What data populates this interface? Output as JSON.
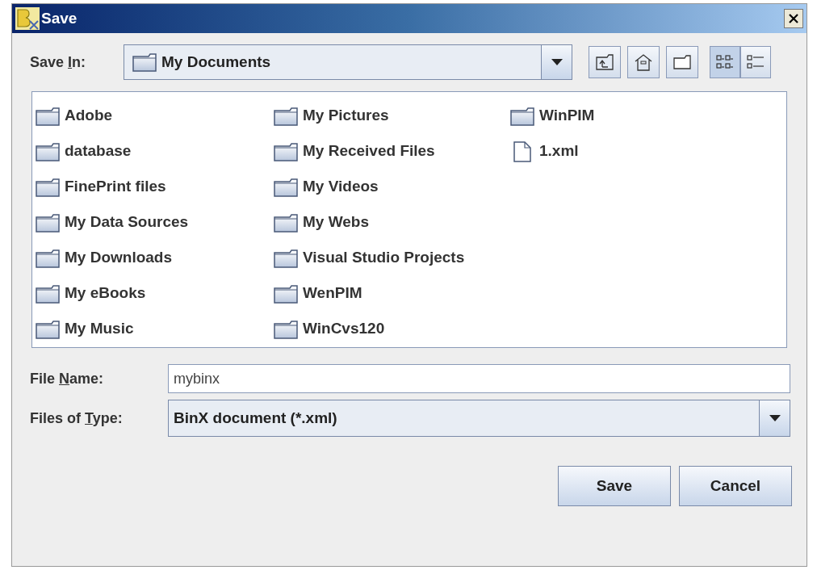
{
  "window": {
    "title": "Save"
  },
  "save_in": {
    "label": {
      "before": "Save ",
      "key": "I",
      "after": "n:"
    },
    "value": "My Documents"
  },
  "toolbar": [
    {
      "kind": "up"
    },
    {
      "kind": "home"
    },
    {
      "kind": "new_folder"
    }
  ],
  "view_toggle": [
    {
      "kind": "list",
      "selected": true
    },
    {
      "kind": "details",
      "selected": false
    }
  ],
  "files": [
    {
      "name": "Adobe",
      "kind": "folder"
    },
    {
      "name": "database",
      "kind": "folder"
    },
    {
      "name": "FinePrint files",
      "kind": "folder"
    },
    {
      "name": "My Data Sources",
      "kind": "folder"
    },
    {
      "name": "My Downloads",
      "kind": "folder"
    },
    {
      "name": "My eBooks",
      "kind": "folder"
    },
    {
      "name": "My Music",
      "kind": "folder"
    },
    {
      "name": "My Pictures",
      "kind": "folder"
    },
    {
      "name": "My Received Files",
      "kind": "folder"
    },
    {
      "name": "My Videos",
      "kind": "folder"
    },
    {
      "name": "My Webs",
      "kind": "folder"
    },
    {
      "name": "Visual Studio Projects",
      "kind": "folder"
    },
    {
      "name": "WenPIM",
      "kind": "folder"
    },
    {
      "name": "WinCvs120",
      "kind": "folder"
    },
    {
      "name": "WinPIM",
      "kind": "folder"
    },
    {
      "name": "1.xml",
      "kind": "file"
    }
  ],
  "file_name": {
    "label": {
      "before": "File ",
      "key": "N",
      "after": "ame:"
    },
    "value": "mybinx"
  },
  "file_type": {
    "label": {
      "before": "Files of ",
      "key": "T",
      "after": "ype:"
    },
    "value": "BinX document (*.xml)"
  },
  "buttons": [
    "Save",
    "Cancel"
  ]
}
